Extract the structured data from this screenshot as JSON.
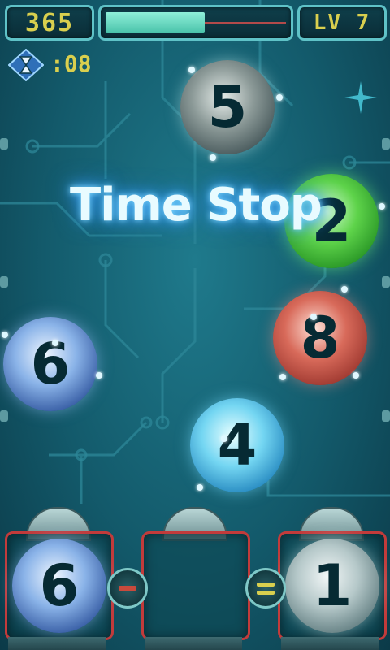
{
  "hud": {
    "score": "365",
    "level": "LV 7",
    "progress": 0.55
  },
  "timer": {
    "icon": "hourglass-icon",
    "value": ":08"
  },
  "banner": {
    "text": "Time Stop"
  },
  "orbs": [
    {
      "value": "5",
      "color": "gray"
    },
    {
      "value": "2",
      "color": "green"
    },
    {
      "value": "8",
      "color": "red"
    },
    {
      "value": "6",
      "color": "blue"
    },
    {
      "value": "4",
      "color": "cyan"
    }
  ],
  "equation": {
    "slot1": "6",
    "operator1": "minus",
    "slot2": "",
    "operator2": "equals",
    "result": "1"
  },
  "colors": {
    "accent_yellow": "#d9cf4e",
    "slot_border": "#c23b3b",
    "progress_fill": "#8ff0da"
  }
}
